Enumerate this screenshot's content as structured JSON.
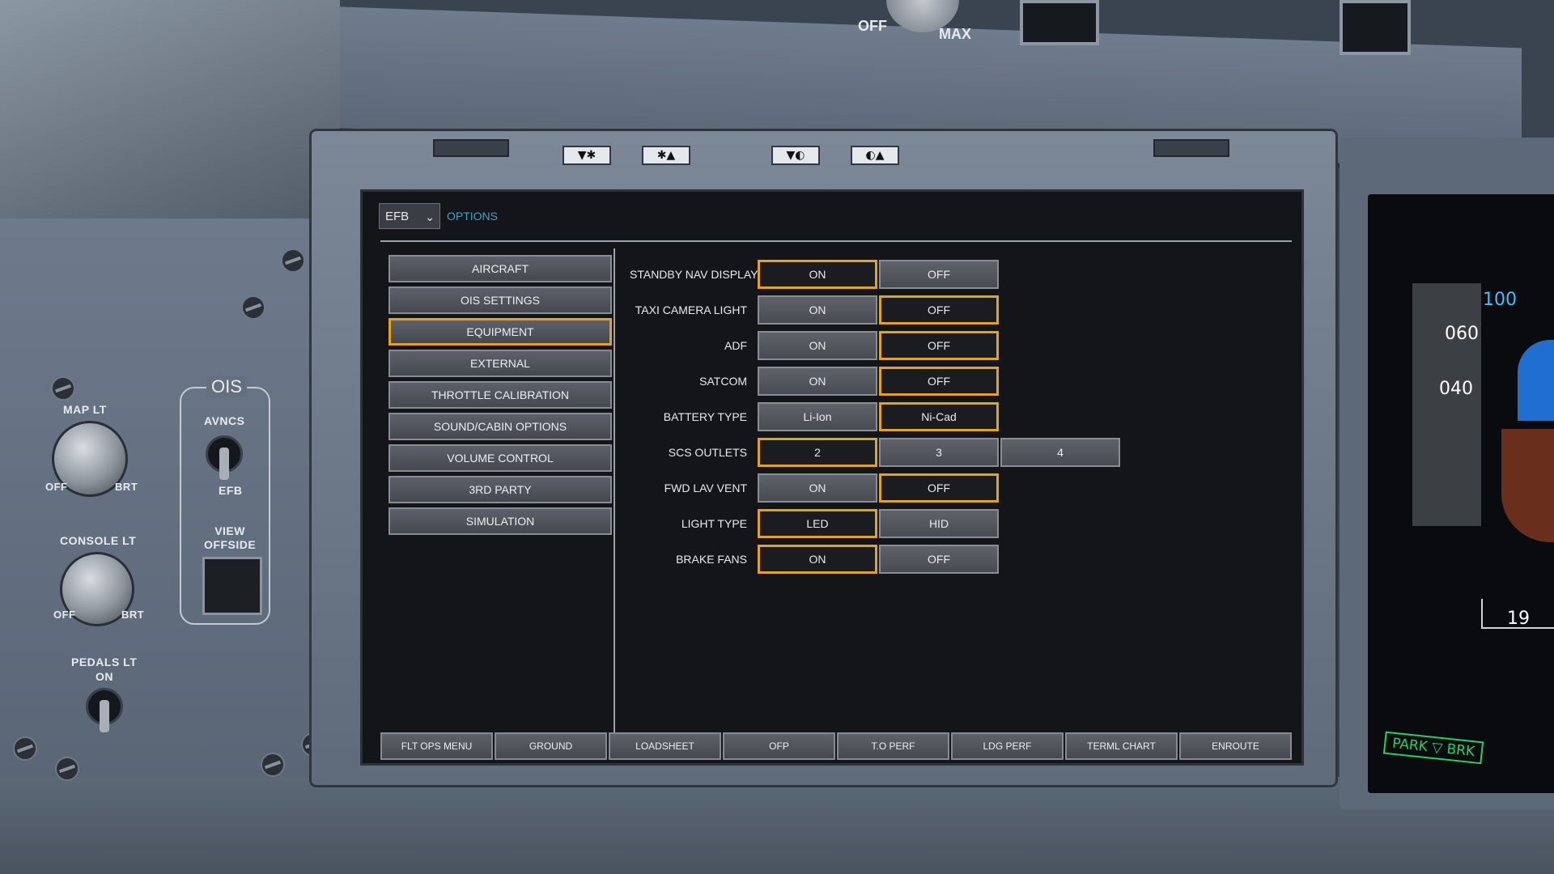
{
  "efb": {
    "app_select": "EFB",
    "page": "OPTIONS",
    "menu": [
      {
        "label": "AIRCRAFT"
      },
      {
        "label": "OIS SETTINGS"
      },
      {
        "label": "EQUIPMENT"
      },
      {
        "label": "EXTERNAL"
      },
      {
        "label": "THROTTLE CALIBRATION"
      },
      {
        "label": "SOUND/CABIN OPTIONS"
      },
      {
        "label": "VOLUME CONTROL"
      },
      {
        "label": "3RD PARTY"
      },
      {
        "label": "SIMULATION"
      }
    ],
    "active_menu": "EQUIPMENT",
    "options": [
      {
        "label": "STANDBY NAV DISPLAY",
        "choices": [
          "ON",
          "OFF"
        ],
        "selected": "ON"
      },
      {
        "label": "TAXI CAMERA LIGHT",
        "choices": [
          "ON",
          "OFF"
        ],
        "selected": "OFF"
      },
      {
        "label": "ADF",
        "choices": [
          "ON",
          "OFF"
        ],
        "selected": "OFF"
      },
      {
        "label": "SATCOM",
        "choices": [
          "ON",
          "OFF"
        ],
        "selected": "OFF"
      },
      {
        "label": "BATTERY TYPE",
        "choices": [
          "Li-Ion",
          "Ni-Cad"
        ],
        "selected": "Ni-Cad"
      },
      {
        "label": "SCS OUTLETS",
        "choices": [
          "2",
          "3",
          "4"
        ],
        "selected": "2"
      },
      {
        "label": "FWD LAV VENT",
        "choices": [
          "ON",
          "OFF"
        ],
        "selected": "OFF"
      },
      {
        "label": "LIGHT TYPE",
        "choices": [
          "LED",
          "HID"
        ],
        "selected": "LED"
      },
      {
        "label": "BRAKE FANS",
        "choices": [
          "ON",
          "OFF"
        ],
        "selected": "ON"
      }
    ],
    "tabs": [
      "FLT OPS MENU",
      "GROUND",
      "LOADSHEET",
      "OFP",
      "T.O PERF",
      "LDG PERF",
      "TERML CHART",
      "ENROUTE"
    ],
    "bezel_keys": [
      "▼✱",
      "✱▲",
      "▼◐",
      "◐▲"
    ]
  },
  "cockpit": {
    "overhead": {
      "off": "OFF",
      "max": "MAX"
    },
    "ois_title": "OIS",
    "map_lt": {
      "label": "MAP LT",
      "off": "OFF",
      "brt": "BRT"
    },
    "console_lt": {
      "label": "CONSOLE LT",
      "off": "OFF",
      "brt": "BRT"
    },
    "pedals_lt": {
      "label": "PEDALS LT",
      "on": "ON"
    },
    "avncs": {
      "label": "AVNCS",
      "efb": "EFB"
    },
    "view_offside": "VIEW\nOFFSIDE",
    "pfd": {
      "target": "100",
      "tick_060": "060",
      "tick_040": "040",
      "scale": "19",
      "park_brk": "PARK ▽ BRK"
    }
  }
}
